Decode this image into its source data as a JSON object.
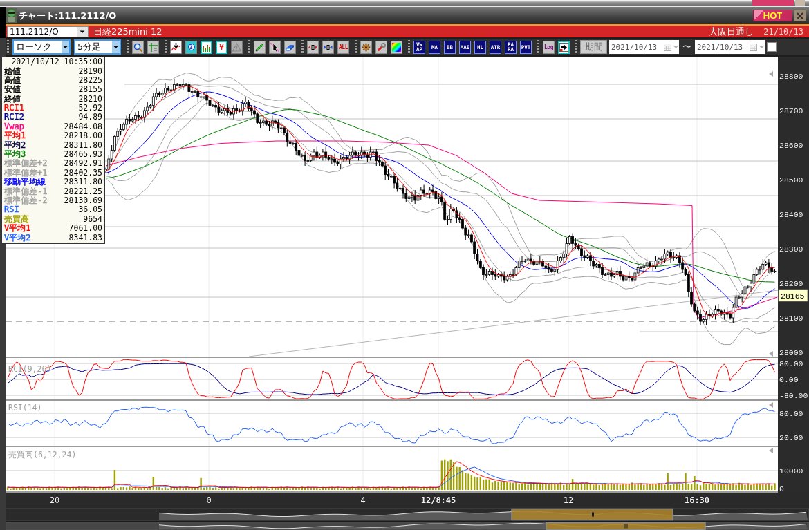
{
  "window": {
    "title": "チャート:111.2112/O",
    "hot_button": "HOT"
  },
  "symbol_bar": {
    "symbol": "111.2112/O",
    "name": "日経225mini 12",
    "session": "大阪日通し",
    "date": "21/10/13"
  },
  "toolbar": {
    "groups": [
      [
        {
          "kind": "combo",
          "value": "ローソク"
        },
        {
          "kind": "combo",
          "value": "5分足"
        }
      ],
      [
        {
          "kind": "icon",
          "disabled": false
        },
        {
          "kind": "icon",
          "disabled": false
        }
      ],
      [
        {
          "kind": "icon",
          "disabled": false
        },
        {
          "kind": "text_icon",
          "label": "2",
          "disabled": false
        },
        {
          "kind": "icon",
          "disabled": false
        },
        {
          "kind": "text_icon",
          "label": "¥",
          "disabled": false
        },
        {
          "kind": "icon",
          "disabled": true
        }
      ],
      [
        {
          "kind": "icon",
          "disabled": false
        },
        {
          "kind": "icon",
          "disabled": false
        },
        {
          "kind": "icon",
          "disabled": false
        }
      ],
      [
        {
          "kind": "icon",
          "disabled": false
        },
        {
          "kind": "icon",
          "disabled": false
        },
        {
          "kind": "text_icon",
          "label": "ALL",
          "disabled": false
        }
      ],
      [
        {
          "kind": "icon",
          "disabled": false
        },
        {
          "kind": "icon",
          "disabled": false
        },
        {
          "kind": "icon",
          "disabled": false
        }
      ],
      [
        {
          "kind": "indicator",
          "label": "VWAP",
          "disabled": false
        },
        {
          "kind": "indicator",
          "label": "MA",
          "disabled": false
        },
        {
          "kind": "indicator",
          "label": "BB",
          "disabled": false
        },
        {
          "kind": "indicator",
          "label": "MAE",
          "disabled": false
        },
        {
          "kind": "indicator",
          "label": "HL",
          "disabled": false
        },
        {
          "kind": "indicator",
          "label": "ATR",
          "disabled": false
        },
        {
          "kind": "indicator",
          "label": "PARA",
          "disabled": false
        },
        {
          "kind": "indicator",
          "label": "PVT",
          "disabled": false
        }
      ],
      [
        {
          "kind": "text_icon",
          "label": "Log",
          "disabled": false
        },
        {
          "kind": "icon",
          "disabled": false
        }
      ],
      [
        {
          "kind": "button",
          "label": "期間"
        },
        {
          "kind": "date",
          "value": "2021/10/13"
        },
        {
          "kind": "separator",
          "text": "〜"
        },
        {
          "kind": "date",
          "value": "2021/10/13"
        },
        {
          "kind": "checkbox",
          "checked": false
        }
      ]
    ]
  },
  "info_panel": {
    "timestamp": "2021/10/12 10:35:00",
    "rows": [
      {
        "label": "始値",
        "value": "28190",
        "color": "#000000"
      },
      {
        "label": "高値",
        "value": "28225",
        "color": "#000000"
      },
      {
        "label": "安値",
        "value": "28155",
        "color": "#000000"
      },
      {
        "label": "終値",
        "value": "28210",
        "color": "#000000"
      },
      {
        "label": "RCI1",
        "value": "-52.92",
        "color": "#ff0000"
      },
      {
        "label": "RCI2",
        "value": "-94.89",
        "color": "#000090"
      },
      {
        "label": "Vwap",
        "value": "28484.08",
        "color": "#ff0080"
      },
      {
        "label": "平均1",
        "value": "28218.00",
        "color": "#ff0000"
      },
      {
        "label": "平均2",
        "value": "28311.80",
        "color": "#000040"
      },
      {
        "label": "平均3",
        "value": "28465.93",
        "color": "#008000"
      },
      {
        "label": "標準偏差+2",
        "value": "28492.91",
        "color": "#a0a0a0"
      },
      {
        "label": "標準偏差+1",
        "value": "28402.35",
        "color": "#a0a0a0"
      },
      {
        "label": "移動平均線",
        "value": "28311.80",
        "color": "#0000ff"
      },
      {
        "label": "標準偏差-1",
        "value": "28221.25",
        "color": "#a0a0a0"
      },
      {
        "label": "標準偏差-2",
        "value": "28130.69",
        "color": "#a0a0a0"
      },
      {
        "label": "RSI",
        "value": "36.05",
        "color": "#2060ff"
      },
      {
        "label": "売買高",
        "value": "9654",
        "color": "#a0a000"
      },
      {
        "label": "V平均1",
        "value": "7061.00",
        "color": "#ff0000"
      },
      {
        "label": "V平均2",
        "value": "8341.83",
        "color": "#2060ff"
      }
    ]
  },
  "price_chart": {
    "axis_labels": [
      "28800",
      "28700",
      "28600",
      "28500",
      "28400",
      "28300",
      "28200",
      "28100",
      "28000"
    ],
    "current_price": "28165"
  },
  "rci_panel": {
    "title": "RCI(9,26)",
    "axis_labels": [
      "80.00",
      "0.00",
      "-80.00"
    ]
  },
  "rsi_panel": {
    "title": "RSI(14)",
    "axis_labels": [
      "80.00",
      "20.00"
    ]
  },
  "volume_panel": {
    "title": "売買高(6,12,24)",
    "axis_labels": [
      "10000",
      "0"
    ]
  },
  "time_axis": {
    "labels": [
      {
        "text": "20",
        "kind": "tick"
      },
      {
        "text": "0",
        "kind": "tick"
      },
      {
        "text": "4",
        "kind": "tick"
      },
      {
        "text": "12/8:45",
        "kind": "session"
      },
      {
        "text": "12",
        "kind": "tick"
      },
      {
        "text": "16:30",
        "kind": "session"
      }
    ]
  }
}
